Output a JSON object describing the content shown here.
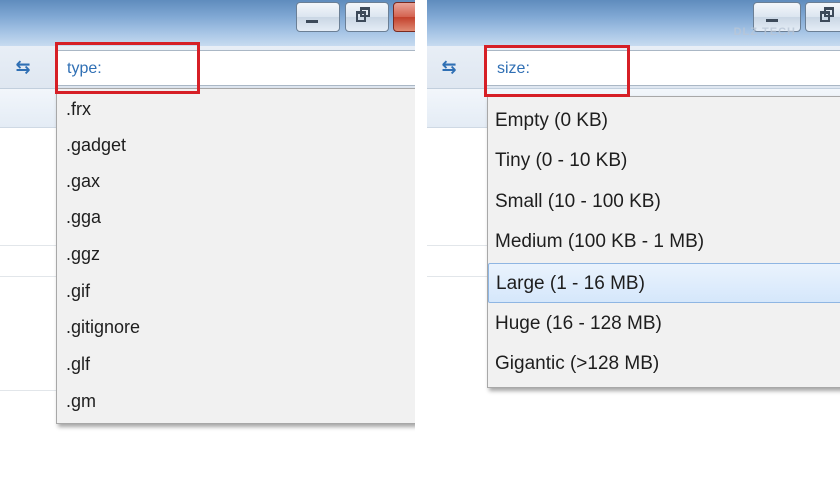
{
  "left_panel": {
    "search_token": "type:",
    "dropdown_items": [
      ".frx",
      ".gadget",
      ".gax",
      ".gga",
      ".ggz",
      ".gif",
      ".gitignore",
      ".glf",
      ".gm"
    ]
  },
  "right_panel": {
    "search_token": "size:",
    "dropdown_items": [
      "Empty (0 KB)",
      "Tiny (0 - 10 KB)",
      "Small (10 - 100 KB)",
      "Medium (100 KB - 1 MB)",
      "Large (1 - 16 MB)",
      "Huge (16 - 128 MB)",
      "Gigantic (>128 MB)"
    ],
    "selected_item": "Large (1 - 16 MB)",
    "watermark": "DLZ TECH"
  },
  "colors": {
    "highlight": "#d61f26",
    "search_token": "#2f6fb4",
    "selected_bg": "#d5e7fb"
  },
  "icons": [
    "minimize-icon",
    "maximize-icon",
    "close-icon",
    "refresh-icon"
  ]
}
